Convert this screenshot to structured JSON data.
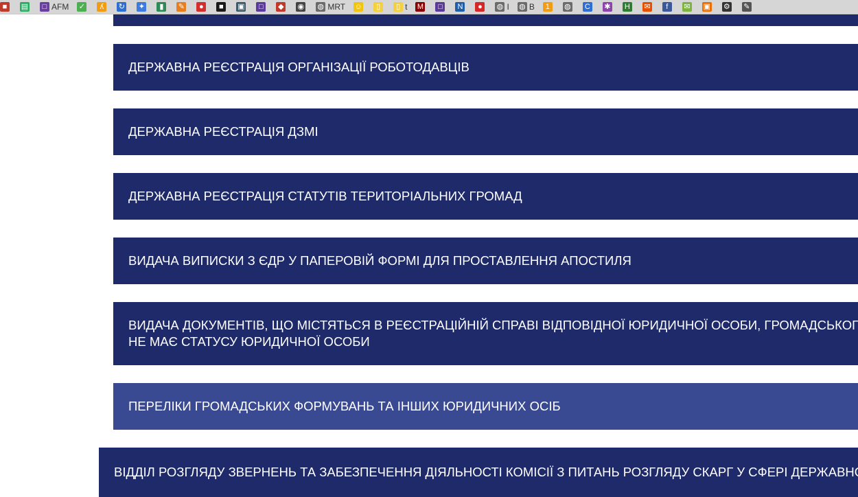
{
  "bookmarks_bar": {
    "items": [
      {
        "icon": "red-cube-icon",
        "label": "",
        "color": "#c0392b",
        "glyph": "■"
      },
      {
        "icon": "green-doc-icon",
        "label": "",
        "color": "#27ae60",
        "glyph": "▤"
      },
      {
        "icon": "purple-square-icon",
        "label": "AFM",
        "color": "#6a3ea1",
        "glyph": "□"
      },
      {
        "icon": "check-icon",
        "label": "",
        "color": "#4caf50",
        "glyph": "✓"
      },
      {
        "icon": "orange-logo-icon",
        "label": "",
        "color": "#f39c12",
        "glyph": "ʎ"
      },
      {
        "icon": "blue-refresh-icon",
        "label": "",
        "color": "#2f6fd1",
        "glyph": "↻"
      },
      {
        "icon": "blue-star-icon",
        "label": "",
        "color": "#3e7be0",
        "glyph": "✦"
      },
      {
        "icon": "green-phone-icon",
        "label": "",
        "color": "#2e8b57",
        "glyph": "▮"
      },
      {
        "icon": "orange-pencil-icon",
        "label": "",
        "color": "#e67e22",
        "glyph": "✎"
      },
      {
        "icon": "red-apple-icon",
        "label": "",
        "color": "#d32f2f",
        "glyph": "●"
      },
      {
        "icon": "black-square-icon",
        "label": "",
        "color": "#1a1a1a",
        "glyph": "■"
      },
      {
        "icon": "dark-photo-icon",
        "label": "",
        "color": "#3c5a6a",
        "glyph": "▣"
      },
      {
        "icon": "purple-box-icon",
        "label": "",
        "color": "#5b3a9c",
        "glyph": "□"
      },
      {
        "icon": "red-diamond-icon",
        "label": "",
        "color": "#c0392b",
        "glyph": "◆"
      },
      {
        "icon": "eye-icon",
        "label": "",
        "color": "#444444",
        "glyph": "◉"
      },
      {
        "icon": "globe-icon",
        "label": "MRT",
        "color": "#6b6b6b",
        "glyph": "◍"
      },
      {
        "icon": "smiley-icon",
        "label": "",
        "color": "#f1c40f",
        "glyph": "☺"
      },
      {
        "icon": "yellow-note-icon",
        "label": "",
        "color": "#f4d03f",
        "glyph": "▯"
      },
      {
        "icon": "yellow-note-icon-2",
        "label": "t",
        "color": "#f4d03f",
        "glyph": "▯"
      },
      {
        "icon": "m-logo-icon",
        "label": "",
        "color": "#8b0000",
        "glyph": "M"
      },
      {
        "icon": "purple-box-icon-2",
        "label": "",
        "color": "#5b3a9c",
        "glyph": "□"
      },
      {
        "icon": "np-logo-icon",
        "label": "",
        "color": "#1f5fa8",
        "glyph": "N"
      },
      {
        "icon": "red-circle-icon",
        "label": "",
        "color": "#d62828",
        "glyph": "●"
      },
      {
        "icon": "globe-icon-2",
        "label": "I",
        "color": "#6b6b6b",
        "glyph": "◍"
      },
      {
        "icon": "globe-icon-3",
        "label": "B",
        "color": "#6b6b6b",
        "glyph": "◍"
      },
      {
        "icon": "orange-104-icon",
        "label": "",
        "color": "#f39c12",
        "glyph": "1"
      },
      {
        "icon": "globe-icon-4",
        "label": "",
        "color": "#6b6b6b",
        "glyph": "◍"
      },
      {
        "icon": "blue-c-icon",
        "label": "",
        "color": "#2f6fd1",
        "glyph": "C"
      },
      {
        "icon": "colorful-star-icon",
        "label": "",
        "color": "#8e44ad",
        "glyph": "✱"
      },
      {
        "icon": "h-logo-icon",
        "label": "",
        "color": "#2e7d32",
        "glyph": "H"
      },
      {
        "icon": "orange-mail-icon",
        "label": "",
        "color": "#e65100",
        "glyph": "✉"
      },
      {
        "icon": "facebook-icon",
        "label": "",
        "color": "#3b5998",
        "glyph": "f"
      },
      {
        "icon": "green-envelope-icon",
        "label": "",
        "color": "#7cb342",
        "glyph": "✉"
      },
      {
        "icon": "orange-box-icon",
        "label": "",
        "color": "#ef6c00",
        "glyph": "▣"
      },
      {
        "icon": "gear-icon",
        "label": "",
        "color": "#333333",
        "glyph": "⚙"
      },
      {
        "icon": "tool-icon",
        "label": "",
        "color": "#555555",
        "glyph": "✎"
      }
    ]
  },
  "menu": {
    "items": [
      {
        "label": "ДЕРЖАВНА РЕЄСТРАЦІЯ ОРГАНІЗАЦІЇ РОБОТОДАВЦІВ"
      },
      {
        "label": "ДЕРЖАВНА РЕЄСТРАЦІЯ ДЗМІ"
      },
      {
        "label": "ДЕРЖАВНА РЕЄСТРАЦІЯ СТАТУТІВ ТЕРИТОРІАЛЬНИХ ГРОМАД"
      },
      {
        "label": "ВИДАЧА ВИПИСКИ З ЄДР У ПАПЕРОВІЙ ФОРМІ ДЛЯ ПРОСТАВЛЕННЯ АПОСТИЛЯ"
      },
      {
        "label_line1": "ВИДАЧА ДОКУМЕНТІВ, ЩО МІСТЯТЬСЯ В РЕЄСТРАЦІЙНІЙ СПРАВІ ВІДПОВІДНОЇ ЮРИДИЧНОЇ ОСОБИ, ГРОМАДСЬКОГО",
        "label_line2": "НЕ МАЄ СТАТУСУ ЮРИДИЧНОЇ ОСОБИ"
      },
      {
        "label": "ПЕРЕЛІКИ ГРОМАДСЬКИХ ФОРМУВАНЬ ТА ІНШИХ ЮРИДИЧНИХ ОСІБ"
      }
    ],
    "section_label": "ВІДДІЛ РОЗГЛЯДУ ЗВЕРНЕНЬ ТА ЗАБЕЗПЕЧЕННЯ ДІЯЛЬНОСТІ КОМІСІЇ З ПИТАНЬ РОЗГЛЯДУ СКАРГ У СФЕРІ ДЕРЖАВНОЇ"
  },
  "colors": {
    "menu_bg": "#1e2a6a",
    "menu_active_bg": "#3a4a92",
    "menu_text": "#ffffff",
    "bookmarks_bg": "#d6d6d6"
  }
}
